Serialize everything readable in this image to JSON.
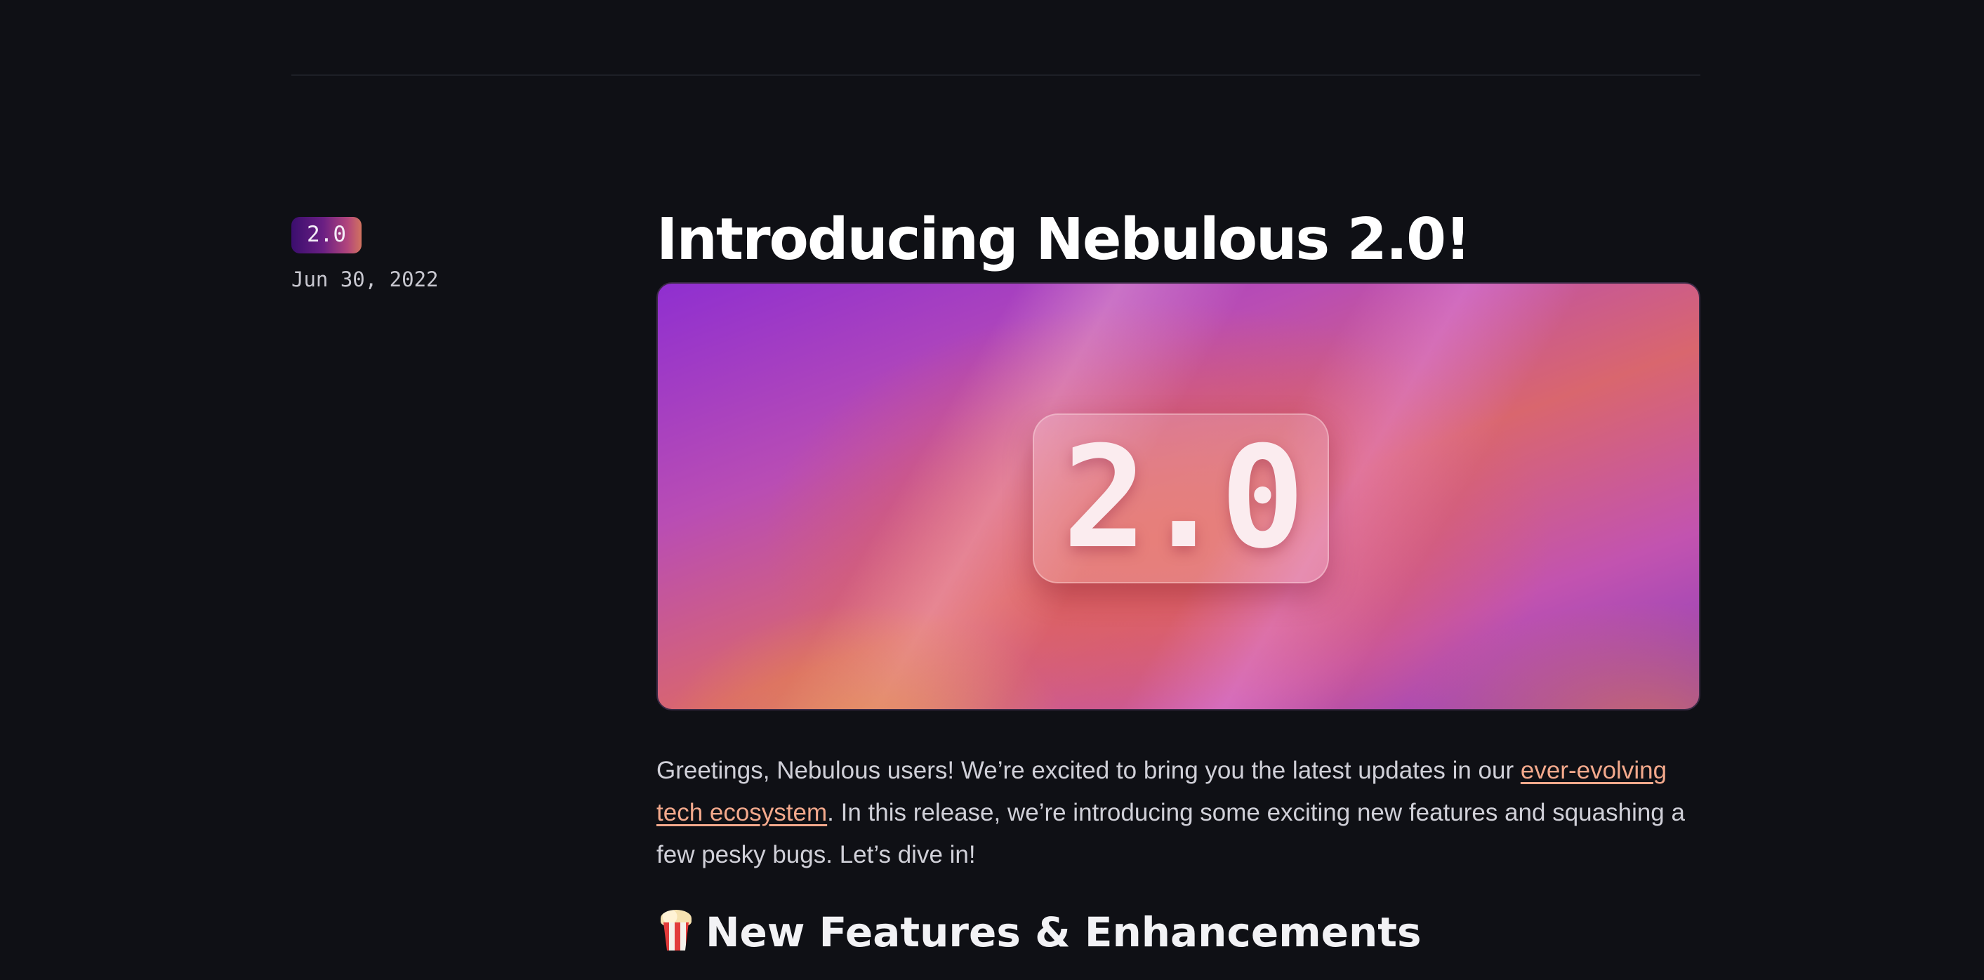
{
  "release": {
    "version_badge": "2.0",
    "date": "Jun 30, 2022",
    "title": "Introducing Nebulous 2.0!",
    "hero_text": "2.0"
  },
  "intro": {
    "text_before_link": "Greetings, Nebulous users! We’re excited to bring you the latest updates in our ",
    "link_text": "ever-evolving tech ecosystem",
    "text_after_link": ". In this release, we’re introducing some exciting new features and squashing a few pesky bugs. Let’s dive in!"
  },
  "section": {
    "icon": "popcorn-icon",
    "heading": "New Features & Enhancements"
  },
  "colors": {
    "background": "#0f1015",
    "link": "#f3a98c",
    "badge_gradient_start": "#3b0e6e",
    "badge_gradient_end": "#d1735f"
  }
}
